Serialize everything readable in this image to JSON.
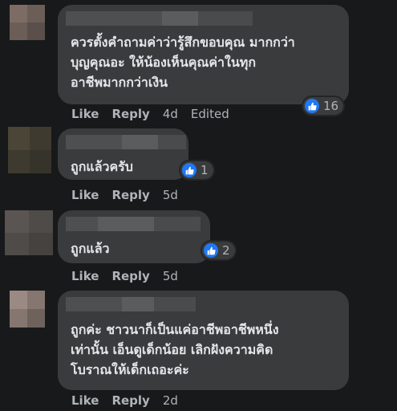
{
  "comments": [
    {
      "text_lines": [
        "ควรตั้งคำถามค่าว่ารู้สึกขอบคุณ มากกว่า",
        "บุญคุณอะ ให้น้องเห็นคุณค่าในทุก",
        "อาชีพมากกว่าเงิน"
      ],
      "reaction_count": "16",
      "like": "Like",
      "reply": "Reply",
      "time": "4d",
      "edited": "Edited"
    },
    {
      "text_lines": [
        "ถูกแล้วครับ"
      ],
      "reaction_count": "1",
      "like": "Like",
      "reply": "Reply",
      "time": "5d"
    },
    {
      "text_lines": [
        "ถูกแล้ว"
      ],
      "reaction_count": "2",
      "like": "Like",
      "reply": "Reply",
      "time": "5d"
    },
    {
      "text_lines": [
        "ถูกค่ะ ชาวนาก็เป็นแค่อาชีพอาชีพหนึ่ง",
        "เท่านั้น เอ็นดูเด็กน้อย เลิกฝังความคิด",
        "โบราณให้เด็กเถอะค่ะ"
      ],
      "like": "Like",
      "reply": "Reply",
      "time": "2d"
    }
  ],
  "colors": {
    "background": "#18191a",
    "bubble": "#3a3b3c",
    "like_blue": "#2078f4",
    "text": "#e4e6eb",
    "secondary": "#b0b3b8"
  }
}
